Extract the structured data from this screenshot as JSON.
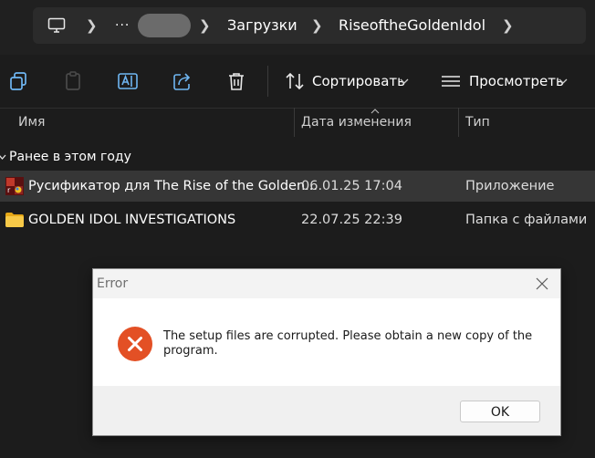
{
  "breadcrumb": {
    "more": "···",
    "items": [
      "Загрузки",
      "RiseoftheGoldenIdol"
    ]
  },
  "toolbar": {
    "sort_label": "Сортировать",
    "view_label": "Просмотреть"
  },
  "columns": {
    "name": "Имя",
    "date": "Дата изменения",
    "type": "Тип"
  },
  "group_label": "Ранее в этом году",
  "files": [
    {
      "name": "Русификатор для The Rise of the Golden...",
      "date": "06.01.25 17:04",
      "type": "Приложение",
      "icon": "app-icon",
      "selected": true
    },
    {
      "name": "GOLDEN IDOL INVESTIGATIONS",
      "date": "22.07.25 22:39",
      "type": "Папка с файлами",
      "icon": "folder-icon",
      "selected": false
    }
  ],
  "dialog": {
    "title": "Error",
    "message": "The setup files are corrupted. Please obtain a new copy of the program.",
    "ok_label": "OK"
  },
  "colors": {
    "background": "#1c1c1c",
    "selection": "#363636",
    "folder": "#f2c141",
    "error": "#e35025"
  }
}
